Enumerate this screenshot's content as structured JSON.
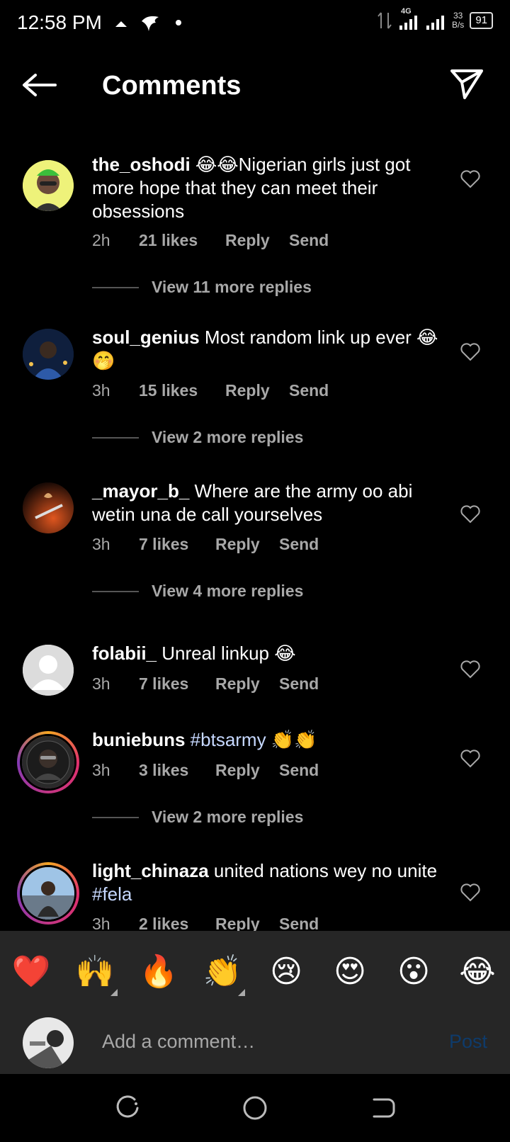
{
  "status_bar": {
    "time": "12:58 PM",
    "network": "4G",
    "speed_value": "33",
    "speed_unit": "B/s",
    "battery": "91"
  },
  "header": {
    "title": "Comments"
  },
  "comments": [
    {
      "username": "the_oshodi",
      "text": " 😂😂Nigerian girls just got more hope that they can meet their obsessions",
      "time": "2h",
      "likes": "21 likes",
      "reply": "Reply",
      "send": "Send",
      "view_replies": "View 11 more replies"
    },
    {
      "username": "soul_genius",
      "text": " Most random link up ever 😂🤭",
      "time": "3h",
      "likes": "15 likes",
      "reply": "Reply",
      "send": "Send",
      "view_replies": "View 2 more replies"
    },
    {
      "username": "_mayor_b_",
      "text": " Where are the army oo abi wetin una de call yourselves",
      "time": "3h",
      "likes": "7 likes",
      "reply": "Reply",
      "send": "Send",
      "view_replies": "View 4 more replies"
    },
    {
      "username": "folabii_",
      "text": " Unreal linkup 😂",
      "time": "3h",
      "likes": "7 likes",
      "reply": "Reply",
      "send": "Send"
    },
    {
      "username": "buniebuns",
      "hashtag": "#btsarmy",
      "text": " 👏👏",
      "time": "3h",
      "likes": "3 likes",
      "reply": "Reply",
      "send": "Send",
      "view_replies": "View 2 more replies"
    },
    {
      "username": "light_chinaza",
      "text": " united nations wey no unite ",
      "hashtag": "#fela",
      "time": "3h",
      "likes": "2 likes",
      "reply": "Reply",
      "send": "Send"
    }
  ],
  "emoji_bar": [
    "❤️",
    "🙌",
    "🔥",
    "👏",
    "😢",
    "😍",
    "😮",
    "😂"
  ],
  "compose": {
    "placeholder": "Add a comment…",
    "post_label": "Post"
  },
  "colors": {
    "background": "#000000",
    "secondary_text": "#a8a8a8",
    "post_disabled": "#0e3b6b",
    "hashtag": "#c6d8ff",
    "panel": "#262626"
  }
}
